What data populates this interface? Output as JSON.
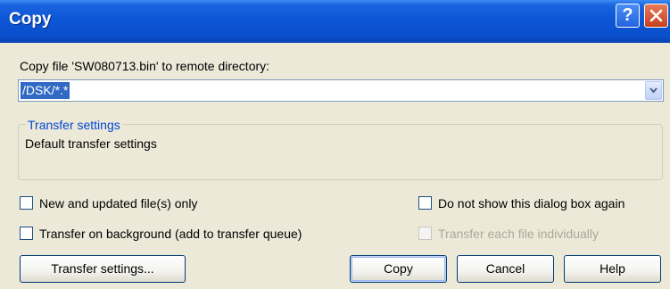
{
  "window": {
    "title": "Copy",
    "help_glyph": "?",
    "close_icon": "close-icon"
  },
  "dialog": {
    "prompt": "Copy file 'SW080713.bin' to remote directory:",
    "target_path": "/DSK/*.*",
    "transfer_group": {
      "legend": "Transfer settings",
      "value": "Default transfer settings"
    },
    "options": {
      "new_updated_only": {
        "label": "New and updated file(s) only",
        "checked": false,
        "enabled": true
      },
      "dont_show_again": {
        "label": "Do not show this dialog box again",
        "checked": false,
        "enabled": true
      },
      "background": {
        "label": "Transfer on background (add to transfer queue)",
        "checked": false,
        "enabled": true
      },
      "each_individually": {
        "label": "Transfer each file individually",
        "checked": false,
        "enabled": false
      }
    },
    "buttons": {
      "transfer_settings": "Transfer settings...",
      "copy": "Copy",
      "cancel": "Cancel",
      "help": "Help"
    }
  },
  "colors": {
    "titlebar": "#0A4FCB",
    "dialog_bg": "#ECE9D8",
    "selection": "#316AC5",
    "group_legend": "#0046D5"
  }
}
